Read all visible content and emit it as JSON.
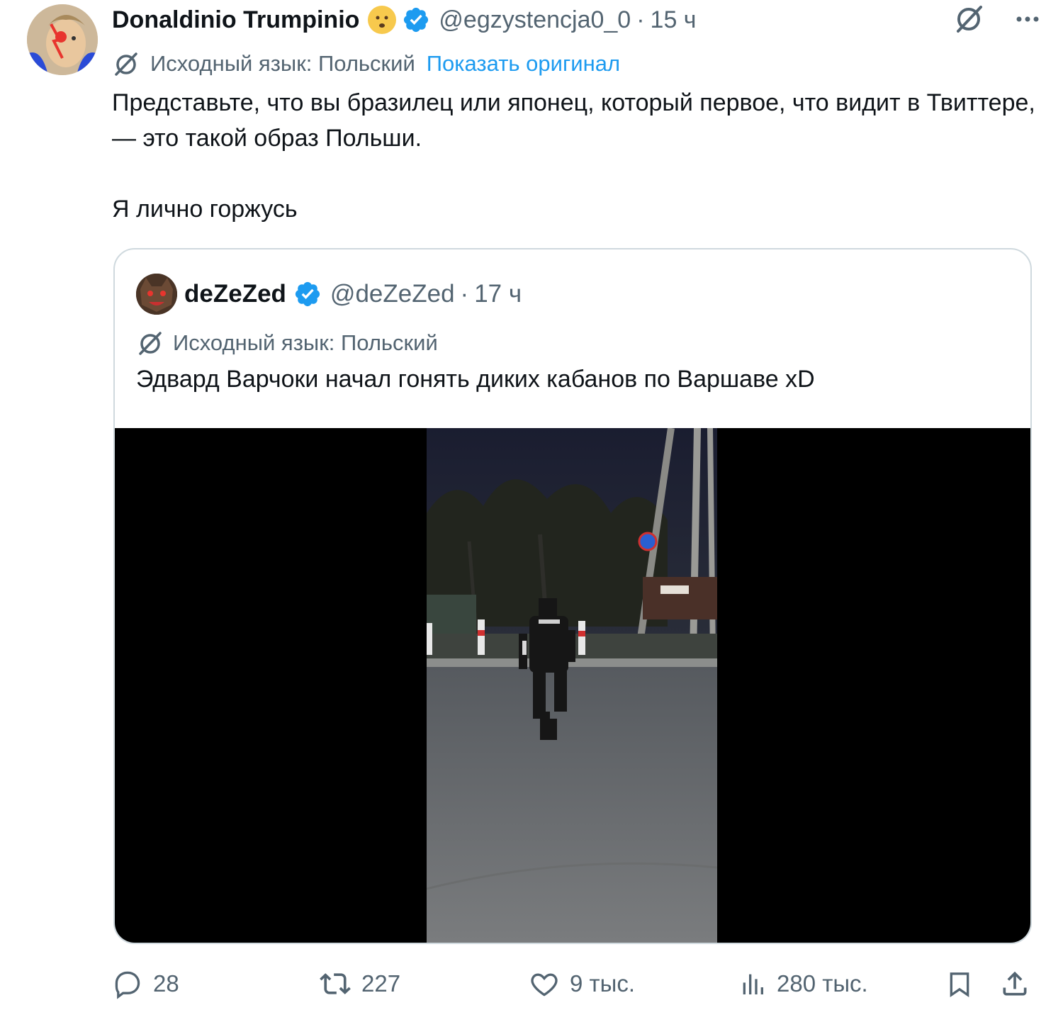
{
  "tweet": {
    "author_name": "Donaldinio Trumpinio",
    "author_handle": "@egzystencja0_0",
    "time": "15 ч",
    "translation_label": "Исходный язык: Польский",
    "show_original": "Показать оригинал",
    "text_line1": "Представьте, что вы бразилец или японец, который первое, что видит в Твиттере, — это такой образ Польши.",
    "text_line2": "Я лично горжусь"
  },
  "quote": {
    "author_name": "deZeZed",
    "author_handle": "@deZeZed",
    "time": "17 ч",
    "translation_label": "Исходный язык: Польский",
    "text": "Эдвард Варчоки начал гонять диких кабанов по Варшаве xD"
  },
  "actions": {
    "replies": "28",
    "retweets": "227",
    "likes": "9 тыс.",
    "views": "280 тыс."
  },
  "colors": {
    "accent": "#1d9bf0",
    "muted": "#536471",
    "border": "#cfd9de"
  }
}
